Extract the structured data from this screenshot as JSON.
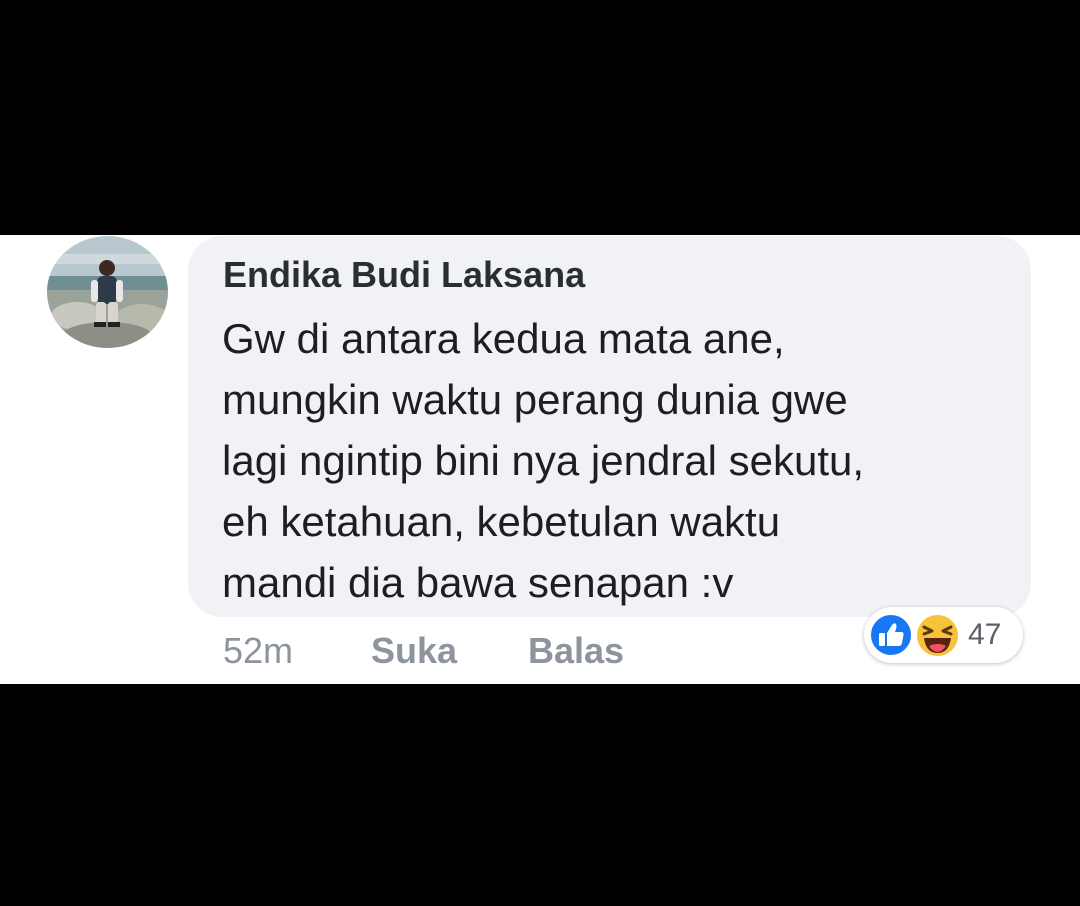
{
  "comment": {
    "author": "Endika Budi Laksana",
    "text_lines": [
      "Gw di antara kedua mata ane,",
      "mungkin waktu perang dunia gwe",
      "lagi ngintip bini nya jendral sekutu,",
      "eh ketahuan, kebetulan waktu",
      "mandi dia bawa senapan :v"
    ],
    "timestamp": "52m",
    "like_label": "Suka",
    "reply_label": "Balas",
    "reactions": {
      "icons": [
        "like-icon",
        "haha-icon"
      ],
      "count": "47",
      "like_color": "#1877f2",
      "haha_color": "#f7c33b"
    }
  },
  "colors": {
    "background": "#000000",
    "panel": "#ffffff",
    "bubble": "#f1f2f6",
    "author_text": "#2a2d33",
    "meta_text": "#8d949e"
  }
}
